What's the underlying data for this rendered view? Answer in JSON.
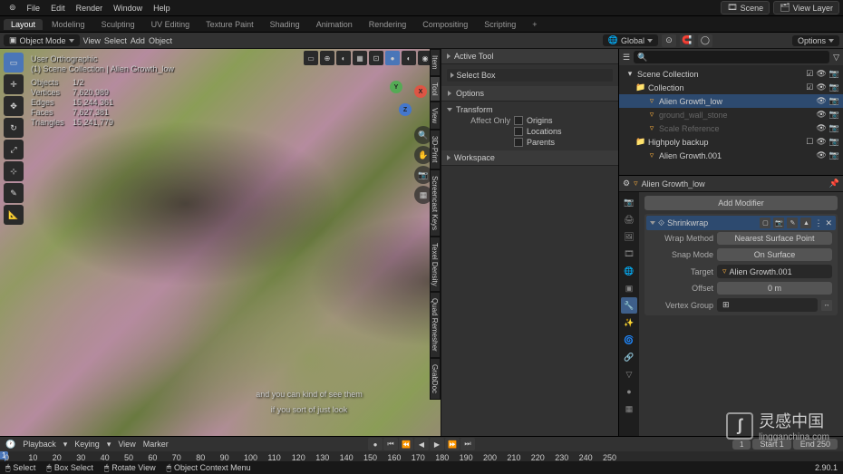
{
  "topmenu": {
    "items": [
      "File",
      "Edit",
      "Render",
      "Window",
      "Help"
    ],
    "scene_label": "Scene",
    "viewlayer_label": "View Layer"
  },
  "workspaces": {
    "tabs": [
      "Layout",
      "Modeling",
      "Sculpting",
      "UV Editing",
      "Texture Paint",
      "Shading",
      "Animation",
      "Rendering",
      "Compositing",
      "Scripting"
    ],
    "active": "Layout"
  },
  "header3": {
    "mode": "Object Mode",
    "menus": [
      "View",
      "Select",
      "Add",
      "Object"
    ],
    "orient": "Global",
    "options": "Options"
  },
  "stats": {
    "title": "User Orthographic",
    "collection": "(1) Scene Collection | Alien Growth_low",
    "objects_lbl": "Objects",
    "objects": "1/2",
    "vertices_lbl": "Vertices",
    "vertices": "7,620,989",
    "edges_lbl": "Edges",
    "edges": "15,244,361",
    "faces_lbl": "Faces",
    "faces": "7,627,381",
    "tris_lbl": "Triangles",
    "tris": "15,241,779"
  },
  "npanel": {
    "active_tool": "Active Tool",
    "select_box": "Select Box",
    "options": "Options",
    "transform": "Transform",
    "affect_only": "Affect Only",
    "origins": "Origins",
    "locations": "Locations",
    "parents": "Parents",
    "workspace": "Workspace"
  },
  "sidetabs": [
    "Item",
    "Tool",
    "View",
    "3D-Print",
    "Screencast Keys",
    "Texel Density",
    "Quad Remesher",
    "GrabDoc"
  ],
  "outliner": {
    "header": "Scene Collection",
    "rows": [
      {
        "indent": 0,
        "icon": "▾",
        "name": "Scene Collection",
        "type": "root"
      },
      {
        "indent": 1,
        "icon": "▾",
        "name": "Collection",
        "type": "coll"
      },
      {
        "indent": 2,
        "icon": "▿",
        "name": "Alien Growth_low",
        "type": "mesh",
        "sel": true
      },
      {
        "indent": 2,
        "icon": "▿",
        "name": "ground_wall_stone",
        "type": "mesh",
        "dim": true
      },
      {
        "indent": 2,
        "icon": "▿",
        "name": "Scale Reference",
        "type": "mesh",
        "dim": true
      },
      {
        "indent": 1,
        "icon": "▾",
        "name": "Highpoly backup",
        "type": "coll",
        "excl": true
      },
      {
        "indent": 2,
        "icon": "▿",
        "name": "Alien Growth.001",
        "type": "mesh"
      }
    ]
  },
  "props": {
    "breadcrumb_obj": "Alien Growth_low",
    "add_modifier": "Add Modifier",
    "mod_name": "Shrinkwrap",
    "wrap_method_lbl": "Wrap Method",
    "wrap_method": "Nearest Surface Point",
    "snap_mode_lbl": "Snap Mode",
    "snap_mode": "On Surface",
    "target_lbl": "Target",
    "target": "Alien Growth.001",
    "offset_lbl": "Offset",
    "offset": "0 m",
    "vgroup_lbl": "Vertex Group",
    "vgroup": ""
  },
  "timeline": {
    "menus": [
      "Playback",
      "Keying",
      "View",
      "Marker"
    ],
    "frame": "1",
    "start_lbl": "Start",
    "start": "1",
    "end_lbl": "End",
    "end": "250",
    "ticks": [
      "0",
      "10",
      "20",
      "30",
      "40",
      "50",
      "60",
      "70",
      "80",
      "90",
      "100",
      "110",
      "120",
      "130",
      "140",
      "150",
      "160",
      "170",
      "180",
      "190",
      "200",
      "210",
      "220",
      "230",
      "240",
      "250"
    ]
  },
  "status": {
    "select": "Select",
    "box": "Box Select",
    "rotate": "Rotate View",
    "menu": "Object Context Menu",
    "version": "2.90.1"
  },
  "subtitle": {
    "l1": "and you can kind of see them",
    "l2": "if you sort of just look"
  },
  "watermark": {
    "cn": "灵感中国",
    "en": "lingganchina.com"
  }
}
